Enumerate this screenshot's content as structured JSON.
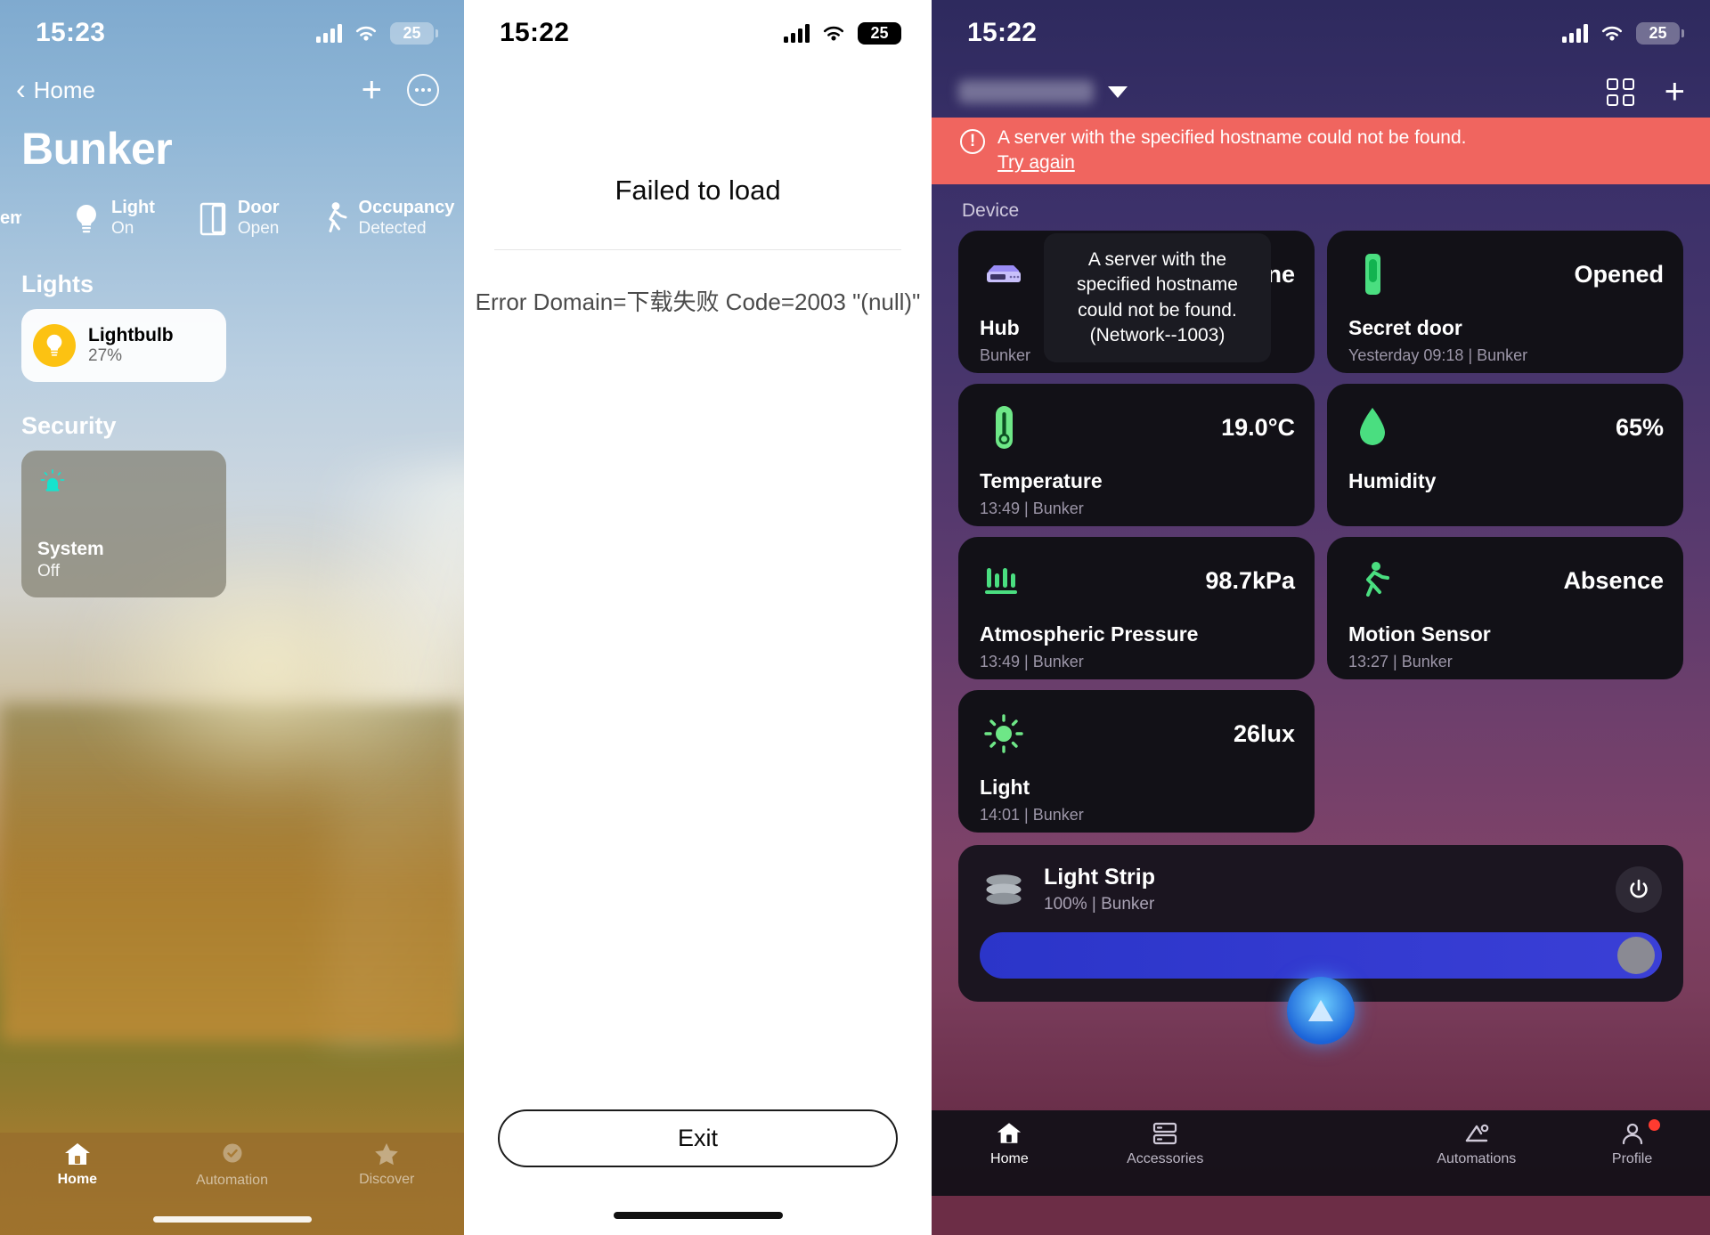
{
  "panel1": {
    "status": {
      "time": "15:23",
      "battery": "25"
    },
    "nav": {
      "back_label": "Home",
      "add_icon": "plus-icon",
      "more_icon": "more-ellipsis-icon"
    },
    "title": "Bunker",
    "chips": [
      {
        "icon": "system-icon",
        "name": "em",
        "state": ""
      },
      {
        "icon": "lightbulb-icon",
        "name": "Light",
        "state": "On"
      },
      {
        "icon": "door-icon",
        "name": "Door",
        "state": "Open"
      },
      {
        "icon": "walking-person-icon",
        "name": "Occupancy",
        "state": "Detected"
      }
    ],
    "sections": [
      {
        "title": "Lights"
      },
      {
        "title": "Security"
      }
    ],
    "light_accessory": {
      "name": "Lightbulb",
      "value": "27%",
      "icon": "lightbulb-icon",
      "accent": "#FCC212"
    },
    "security_accessory": {
      "name": "System",
      "value": "Off",
      "icon": "alarm-siren-icon",
      "accent": "#16E3CE"
    },
    "tabs": [
      {
        "label": "Home",
        "icon": "home-icon",
        "active": true
      },
      {
        "label": "Automation",
        "icon": "clock-check-icon",
        "active": false
      },
      {
        "label": "Discover",
        "icon": "star-icon",
        "active": false
      }
    ]
  },
  "panel2": {
    "status": {
      "time": "15:22",
      "battery": "25"
    },
    "title": "Failed to load",
    "error_detail": "Error Domain=下载失败 Code=2003 \"(null)\"",
    "exit_label": "Exit"
  },
  "panel3": {
    "status": {
      "time": "15:22",
      "battery": "25"
    },
    "nav": {
      "home_name_redacted": "",
      "caret_icon": "chevron-down-icon",
      "grid_icon": "grid-view-icon",
      "add_icon": "plus-icon"
    },
    "banner": {
      "icon": "warning-circle-icon",
      "message": "A server with the specified hostname could not be found.",
      "action": "Try again",
      "color": "#F0655F"
    },
    "section_label": "Device",
    "tooltip": "A server with the specified hostname could not be found.(Network--1003)",
    "devices": [
      {
        "icon": "hub-device-icon",
        "value": "Online",
        "name": "Hub",
        "meta": "Bunker",
        "accent": "#9a8cf5"
      },
      {
        "icon": "door-sensor-icon",
        "value": "Opened",
        "name": "Secret door",
        "meta": "Yesterday 09:18 | Bunker",
        "accent": "#4ade80"
      },
      {
        "icon": "thermometer-icon",
        "value": "19.0°C",
        "name": "Temperature",
        "meta": "13:49 | Bunker",
        "accent": "#6ee787"
      },
      {
        "icon": "humidity-drop-icon",
        "value": "65%",
        "name": "Humidity",
        "meta": "",
        "accent": "#4ade80"
      },
      {
        "icon": "pressure-gauge-icon",
        "value": "98.7kPa",
        "name": "Atmospheric Pressure",
        "meta": "13:49 | Bunker",
        "accent": "#4ade80"
      },
      {
        "icon": "motion-runner-icon",
        "value": "Absence",
        "name": "Motion Sensor",
        "meta": "13:27 | Bunker",
        "accent": "#4ade80"
      },
      {
        "icon": "brightness-sun-icon",
        "value": "26lux",
        "name": "Light",
        "meta": "14:01 | Bunker",
        "accent": "#6ee787"
      }
    ],
    "light_strip": {
      "icon": "light-strip-icon",
      "name": "Light Strip",
      "meta": "100% | Bunker",
      "power_icon": "power-icon",
      "slider_value": "100"
    },
    "tabs": [
      {
        "label": "Home",
        "icon": "home-icon",
        "active": true
      },
      {
        "label": "Accessories",
        "icon": "accessories-icon",
        "active": false
      },
      {
        "label": "",
        "icon": "assistant-orb-icon",
        "active": false
      },
      {
        "label": "Automations",
        "icon": "automations-icon",
        "active": false
      },
      {
        "label": "Profile",
        "icon": "profile-icon",
        "active": false,
        "badge": true
      }
    ]
  }
}
